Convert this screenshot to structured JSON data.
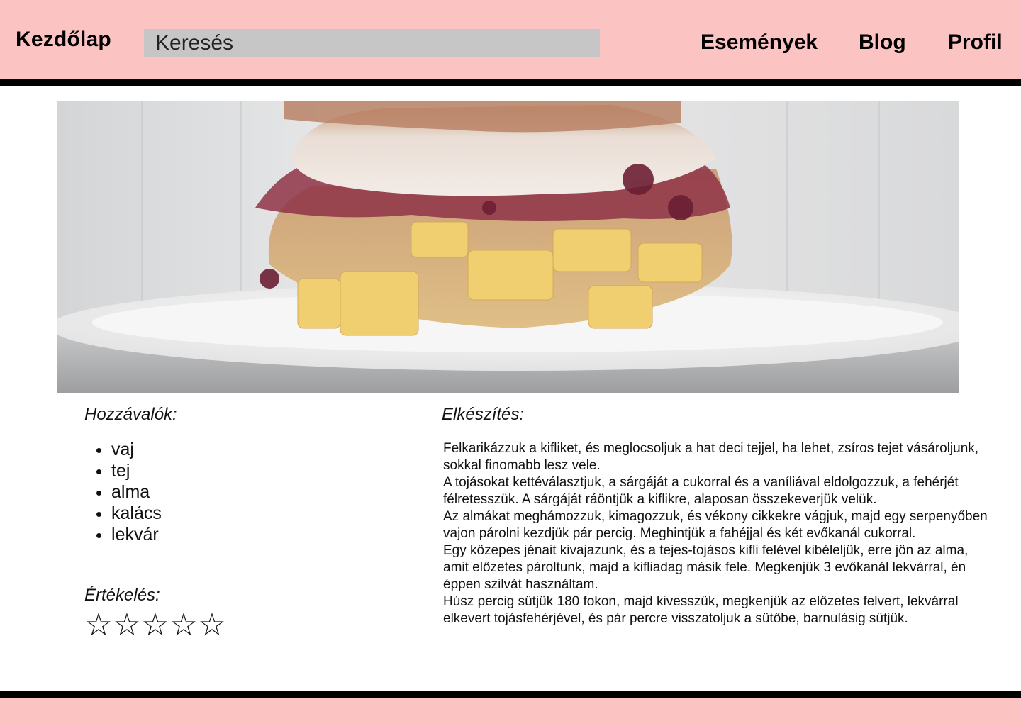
{
  "header": {
    "home_label": "Kezdőlap",
    "search_placeholder": "Keresés",
    "nav": {
      "events": "Események",
      "blog": "Blog",
      "profile": "Profil"
    }
  },
  "colors": {
    "header_bg": "#fcc3c3",
    "rule": "#000000",
    "search_bg": "#c6c6c6"
  },
  "hero": {
    "icon": "recipe-photo"
  },
  "ingredients": {
    "title": "Hozzávalók:",
    "items": [
      "vaj",
      "tej",
      "alma",
      "kalács",
      "lekvár"
    ]
  },
  "rating": {
    "title": "Értékelés:",
    "value": 0,
    "max": 5,
    "star_glyph": "☆"
  },
  "method": {
    "title": "Elkészítés:",
    "paragraphs": [
      "Felkarikázzuk a kifliket, és meglocsoljuk a hat deci tejjel, ha lehet, zsíros tejet vásároljunk, sokkal finomabb lesz vele.",
      "A tojásokat kettéválasztjuk, a sárgáját a cukorral és a vaníliával eldolgozzuk, a fehérjét félretesszük. A sárgáját ráöntjük a kiflikre, alaposan összekeverjük velük.",
      "Az almákat meghámozzuk, kimagozzuk, és vékony cikkekre vágjuk, majd egy serpenyőben vajon párolni kezdjük pár percig. Meghintjük a fahéjjal és két evőkanál cukorral.",
      "Egy közepes jénait kivajazunk, és a tejes-tojásos kifli felével kibéleljük, erre jön az alma, amit előzetes pároltunk, majd a kifliadag másik fele. Megkenjük 3 evőkanál lekvárral, én éppen szilvát használtam.",
      "Húsz percig sütjük 180 fokon, majd kivesszük, megkenjük az előzetes felvert, lekvárral elkevert tojásfehérjével, és pár percre visszatoljuk a sütőbe, barnulásig sütjük."
    ]
  }
}
